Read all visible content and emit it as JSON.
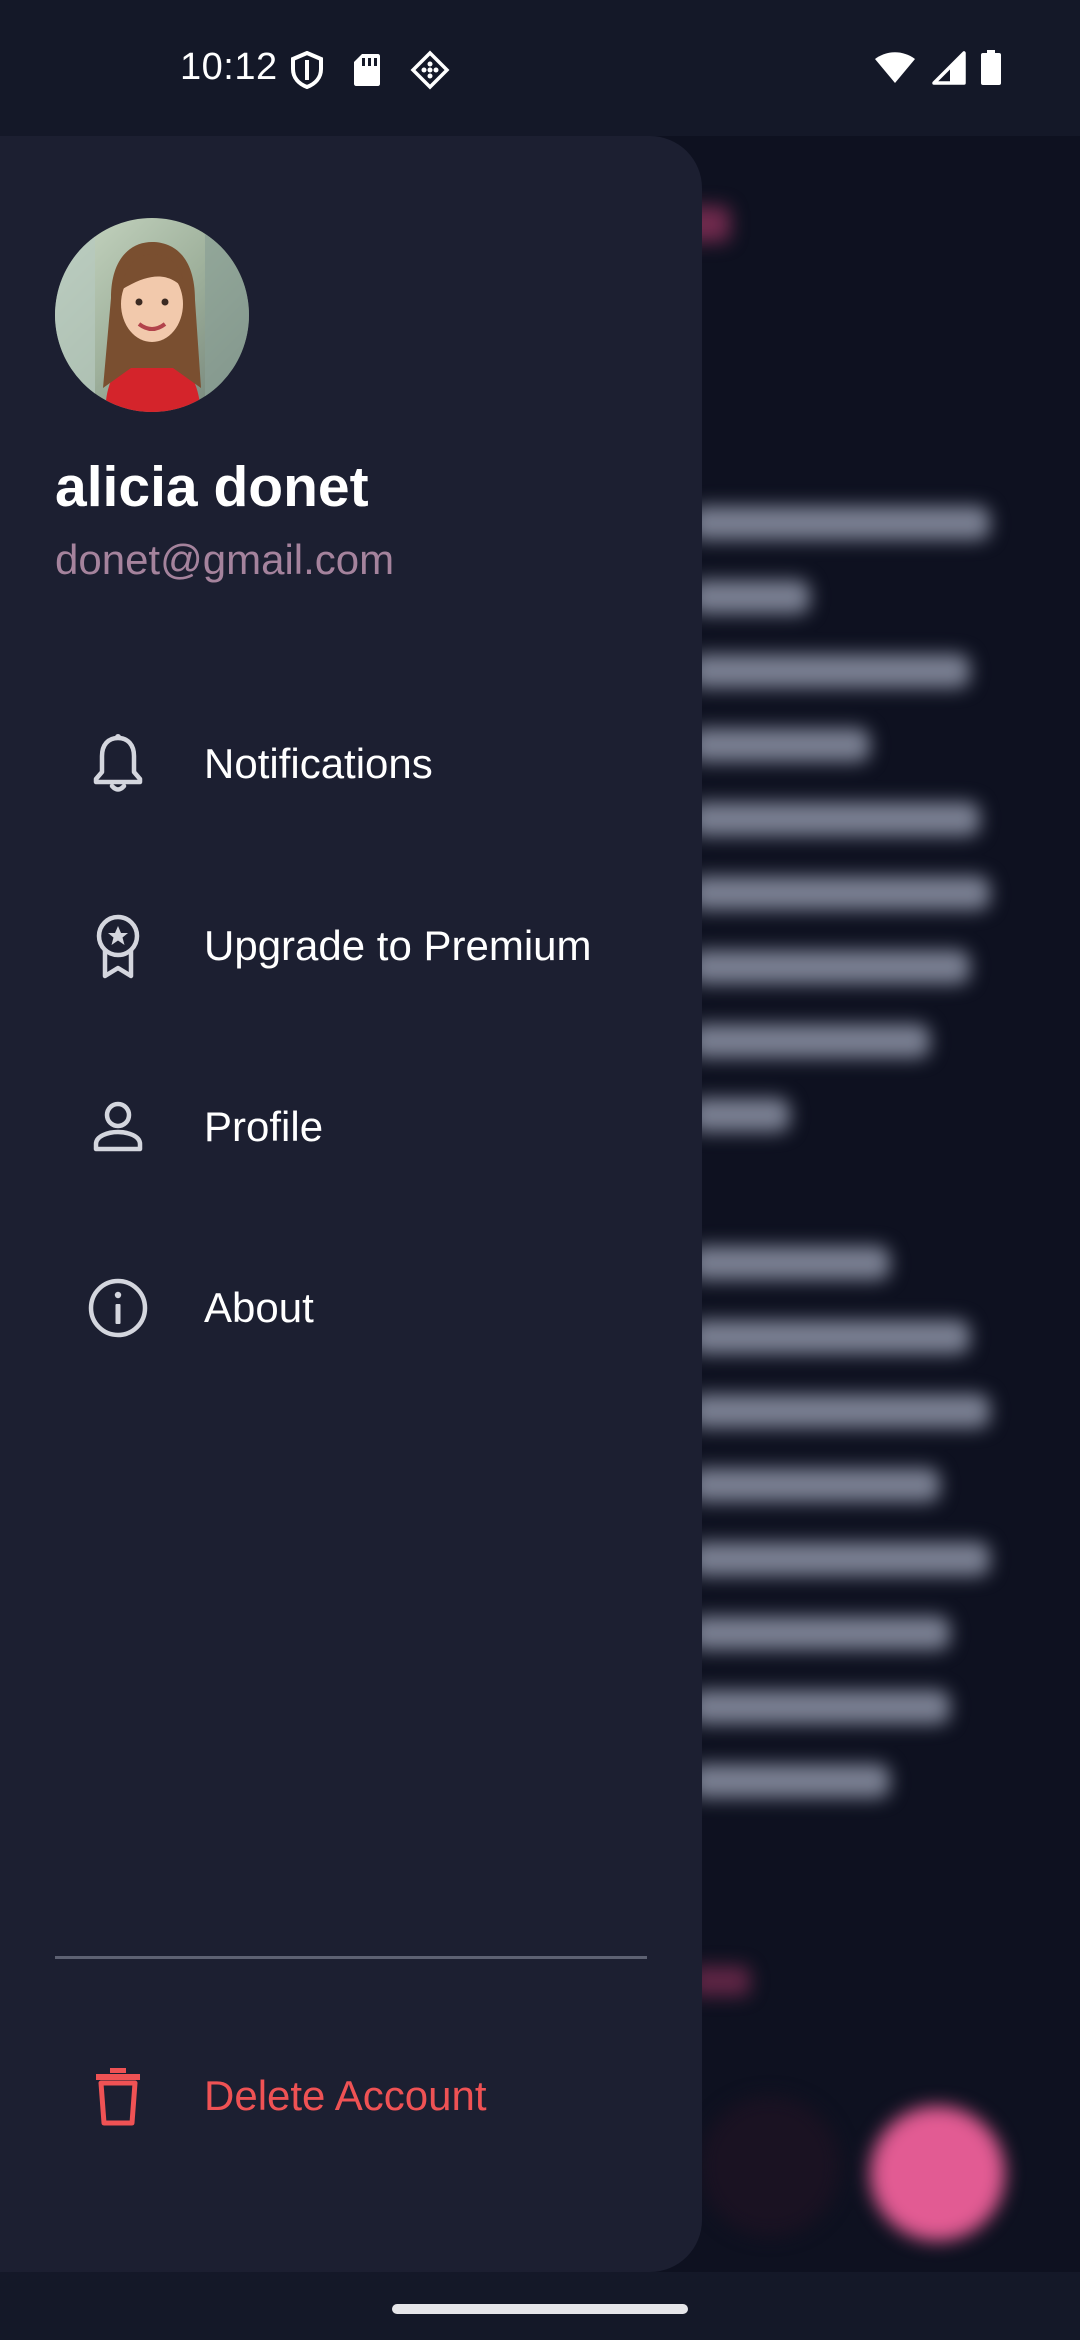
{
  "status_bar": {
    "time": "10:12",
    "left_icons": [
      "shield-icon",
      "sd-card-icon",
      "app-diamond-icon"
    ],
    "right_icons": [
      "wifi-icon",
      "cell-signal-icon",
      "battery-icon"
    ]
  },
  "drawer": {
    "user": {
      "name": "alicia donet",
      "email": "donet@gmail.com"
    },
    "menu": [
      {
        "label": "Notifications",
        "icon": "bell-icon"
      },
      {
        "label": "Upgrade to Premium",
        "icon": "premium-badge-icon"
      },
      {
        "label": "Profile",
        "icon": "person-icon"
      },
      {
        "label": "About",
        "icon": "info-icon"
      }
    ],
    "delete": {
      "label": "Delete Account",
      "icon": "trash-icon"
    }
  },
  "colors": {
    "drawer_bg": "#1c1f31",
    "background": "#0e1120",
    "email": "#a5839d",
    "danger": "#ef5254",
    "fab": "#e25b93",
    "icon": "#d4d6de"
  }
}
